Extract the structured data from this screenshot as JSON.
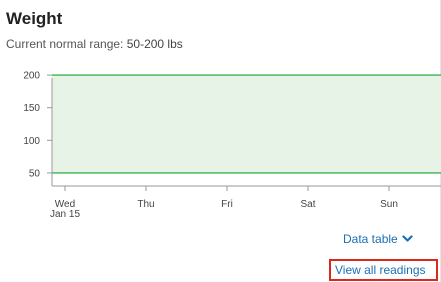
{
  "card": {
    "title": "Weight",
    "range_label": "Current normal range: ",
    "range_value": "50-200 lbs"
  },
  "chart_data": {
    "type": "area",
    "title": "",
    "xlabel": "",
    "ylabel": "",
    "categories": [
      "Wed\nJan 15",
      "Thu",
      "Fri",
      "Sat",
      "Sun"
    ],
    "yticks": [
      50,
      100,
      150,
      200
    ],
    "ylim": [
      30,
      220
    ],
    "normal_range": {
      "low": 50,
      "high": 200
    },
    "series": [],
    "grid": false,
    "colors": {
      "band_fill": "#e6f3e6",
      "band_line": "#3fb34f",
      "axis": "#999999"
    }
  },
  "links": {
    "data_table": "Data table",
    "view_all": "View all readings"
  }
}
